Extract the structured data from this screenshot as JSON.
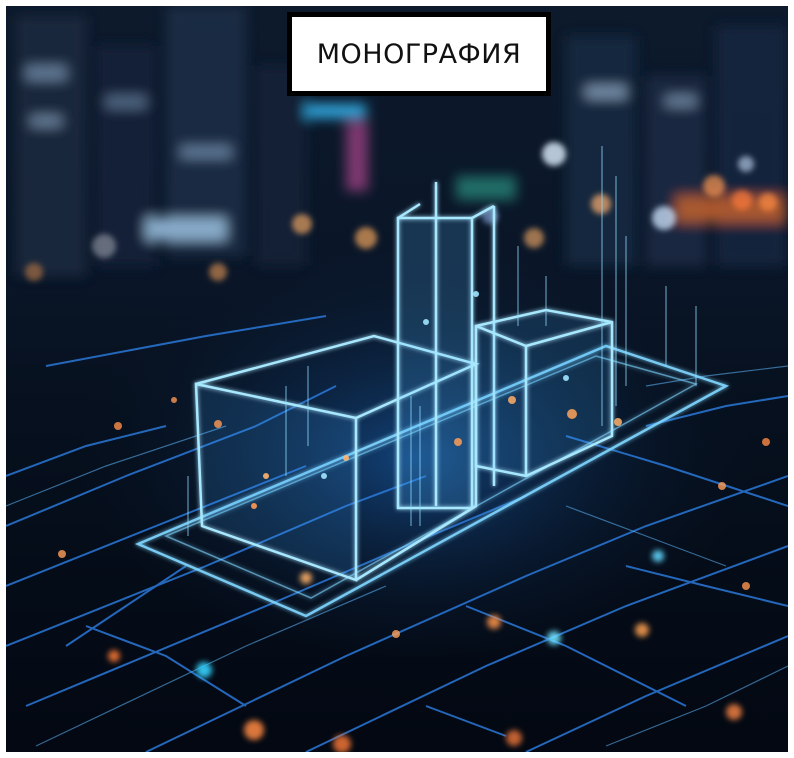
{
  "title": "МОНОГРАФИЯ",
  "colors": {
    "frame": "#000000",
    "title_background": "#ffffff",
    "title_text": "#111111",
    "hologram_glow": "#4fc3ff",
    "bokeh_warm": "#ff8a3c",
    "night_sky": "#0a1628"
  },
  "illustration": "holographic-building-on-circuit-board-night-city"
}
